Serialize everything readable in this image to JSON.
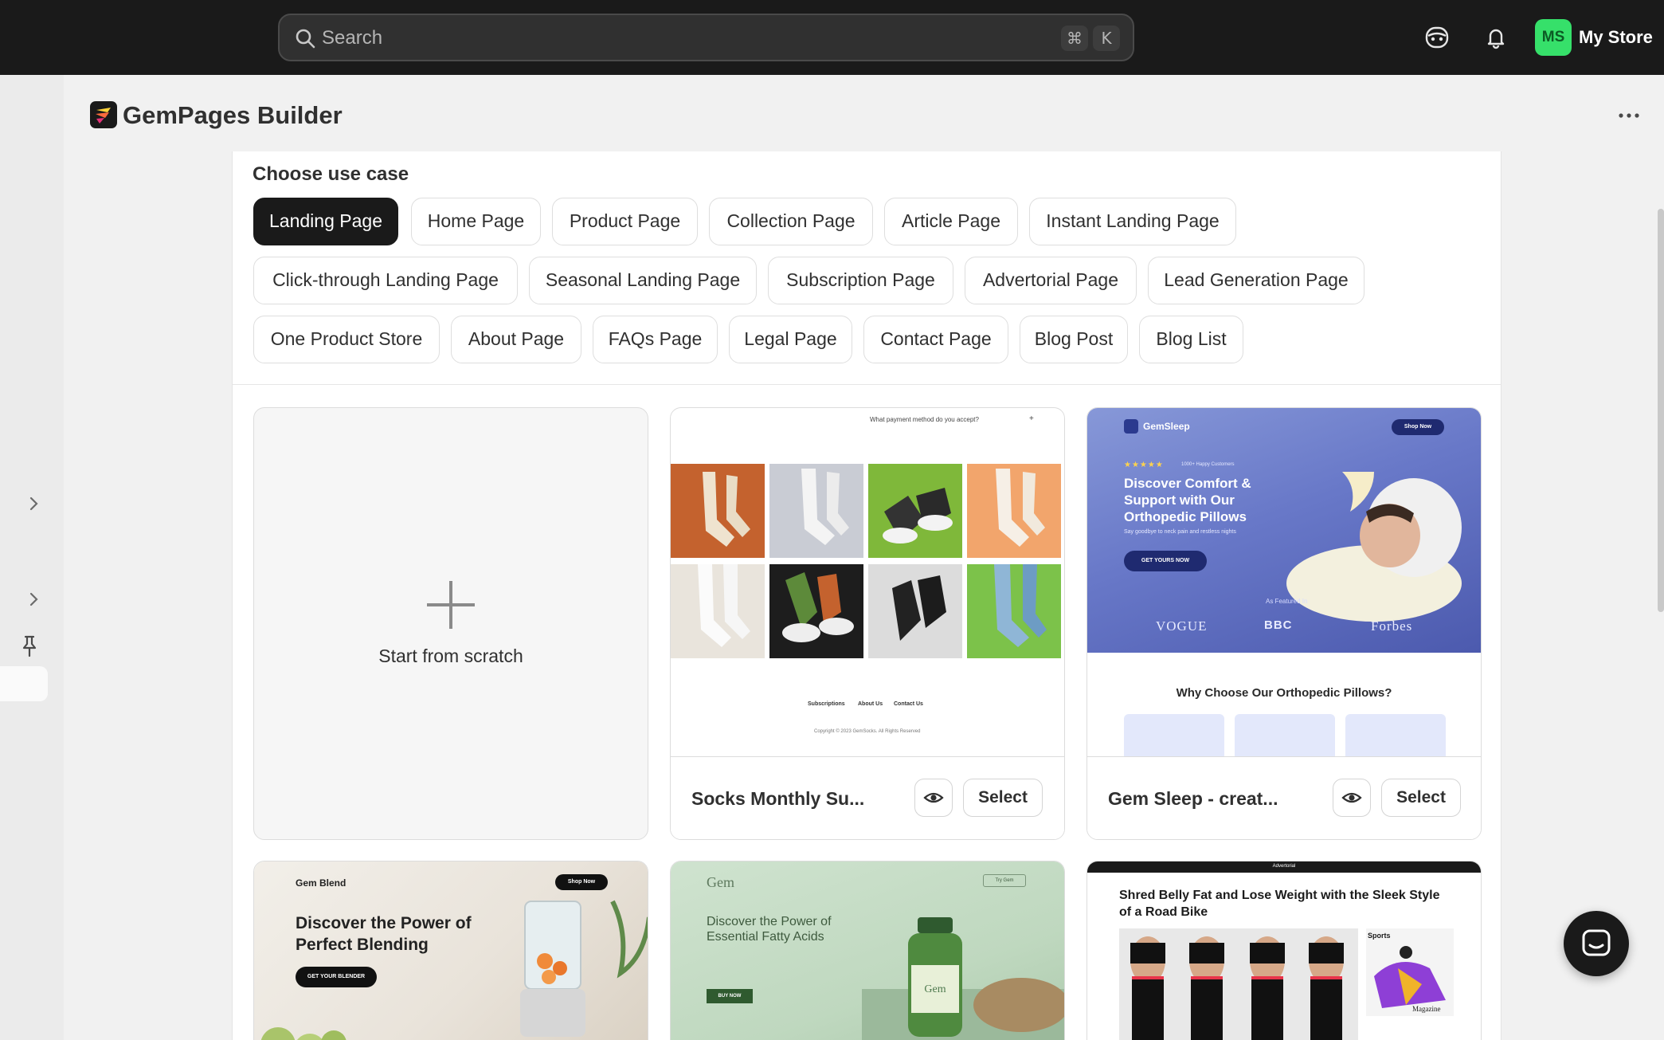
{
  "topbar": {
    "search_placeholder": "Search",
    "shortcut_cmd": "⌘",
    "shortcut_key": "K",
    "store_initials": "MS",
    "store_name": "My Store",
    "colors": {
      "bar": "#1a1a1a",
      "avatar": "#36e06a"
    }
  },
  "app": {
    "title": "GemPages Builder"
  },
  "use_case": {
    "title": "Choose use case",
    "chips": [
      {
        "label": "Landing Page",
        "active": true
      },
      {
        "label": "Home Page"
      },
      {
        "label": "Product Page"
      },
      {
        "label": "Collection Page"
      },
      {
        "label": "Article Page"
      },
      {
        "label": "Instant Landing Page"
      },
      {
        "label": "Click-through Landing Page"
      },
      {
        "label": "Seasonal Landing Page"
      },
      {
        "label": "Subscription Page"
      },
      {
        "label": "Advertorial Page"
      },
      {
        "label": "Lead Generation Page"
      },
      {
        "label": "One Product Store"
      },
      {
        "label": "About Page"
      },
      {
        "label": "FAQs Page"
      },
      {
        "label": "Legal Page"
      },
      {
        "label": "Contact Page"
      },
      {
        "label": "Blog Post"
      },
      {
        "label": "Blog List"
      }
    ]
  },
  "templates": {
    "scratch_label": "Start from scratch",
    "select_label": "Select",
    "items": [
      {
        "name": "Socks Monthly Su...",
        "preview": {
          "question": "What payment method do you accept?",
          "links": [
            "Subscriptions",
            "About Us",
            "Contact Us"
          ],
          "copyright": "Copyright © 2023 GemSocks. All Rights Reserved"
        }
      },
      {
        "name": "Gem Sleep - creat...",
        "preview": {
          "brand": "GemSleep",
          "shop": "Shop Now",
          "rating": "★★★★★",
          "rating_text": "1000+ Happy Customers",
          "headline": "Discover Comfort & Support with Our Orthopedic Pillows",
          "sub": "Say goodbye to neck pain and restless nights",
          "cta": "GET YOURS NOW",
          "featured": "As Featured In",
          "press": [
            "VOGUE",
            "BBC",
            "Forbes"
          ],
          "why": "Why Choose Our Orthopedic Pillows?"
        }
      },
      {
        "preview": {
          "brand": "Gem Blend",
          "shop": "Shop Now",
          "headline": "Discover the Power of Perfect Blending",
          "cta": "GET YOUR BLENDER"
        }
      },
      {
        "preview": {
          "brand": "Gem",
          "tag": "Try Gem",
          "headline": "Discover the Power of Essential Fatty Acids",
          "cta": "BUY NOW",
          "bottle_label": "Gem"
        }
      },
      {
        "preview": {
          "top": "Advertorial",
          "headline": "Shred Belly Fat and Lose Weight with the Sleek Style of a Road Bike",
          "sports": "Sports",
          "magazine": "Magazine"
        }
      }
    ]
  }
}
